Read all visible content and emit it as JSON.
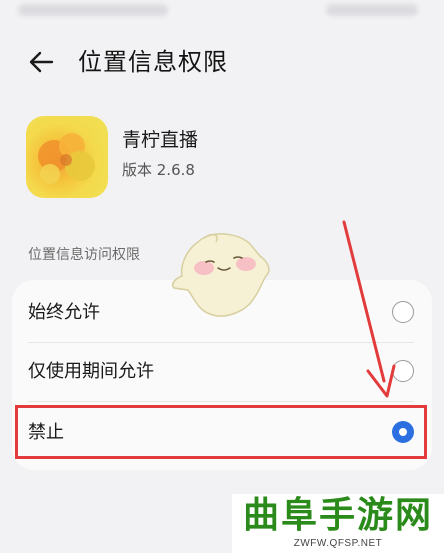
{
  "header": {
    "title": "位置信息权限",
    "back_icon": "arrow-left-icon"
  },
  "app": {
    "name": "青柠直播",
    "version": "版本 2.6.8",
    "icon": "app-icon"
  },
  "section": {
    "title": "位置信息访问权限"
  },
  "options": [
    {
      "label": "始终允许",
      "selected": false
    },
    {
      "label": "仅使用期间允许",
      "selected": false
    },
    {
      "label": "禁止",
      "selected": true
    }
  ],
  "watermark": {
    "title": "曲阜手游网",
    "url": "ZWFW.QFSP.NET"
  },
  "colors": {
    "accent": "#2c6fe0",
    "highlight": "#e33b3b",
    "watermark": "#2a8a1a"
  }
}
